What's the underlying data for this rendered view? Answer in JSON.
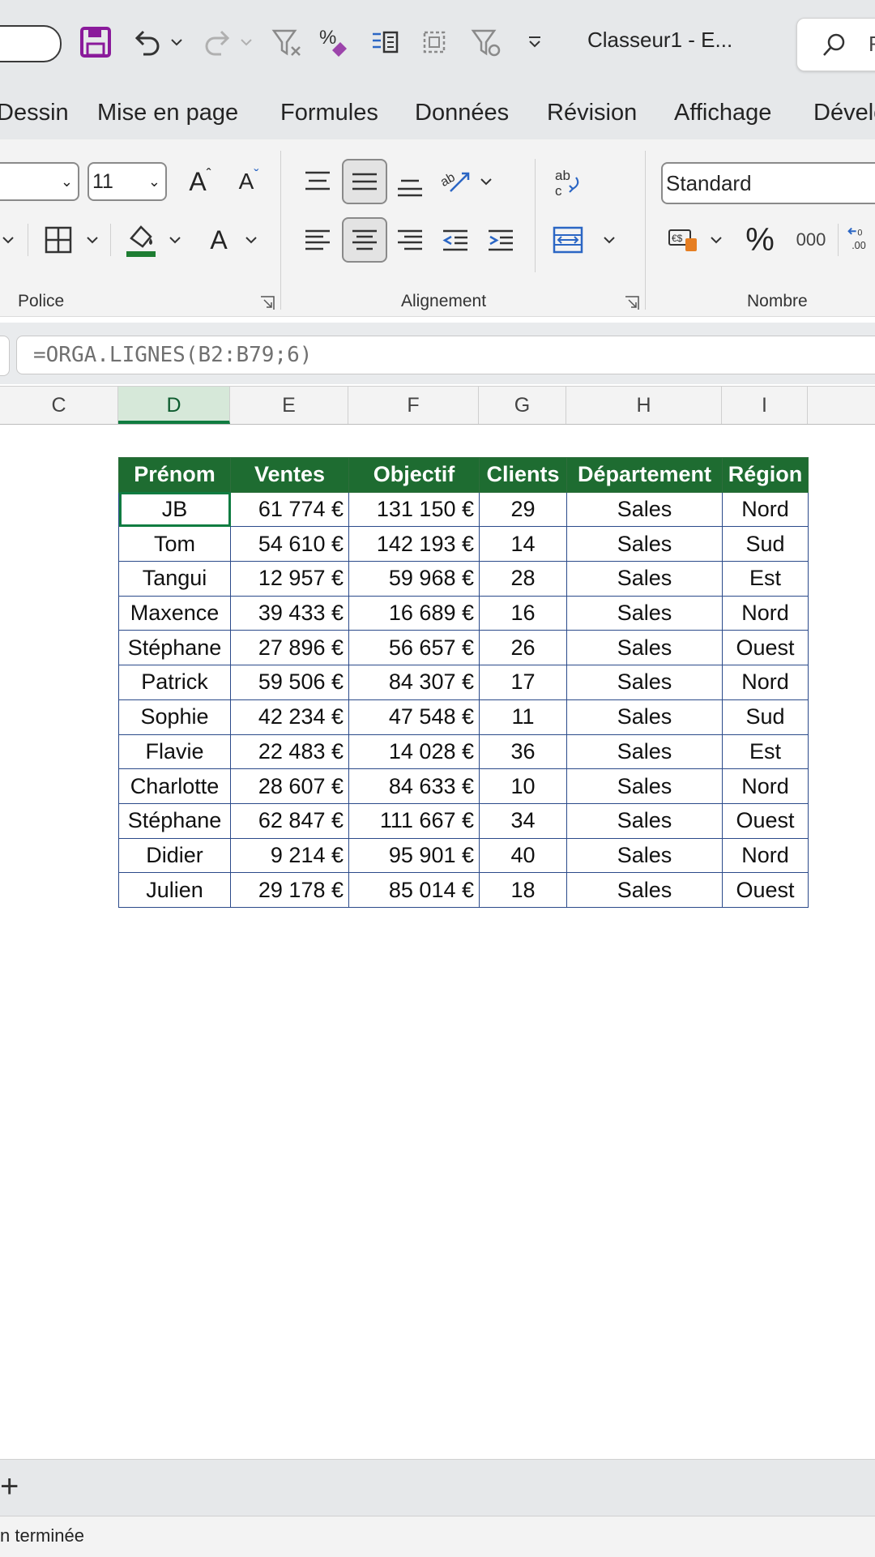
{
  "titlebar": {
    "doc_title": "Classeur1  -  E...",
    "search_placeholder_fragment": "R"
  },
  "tabs": [
    "Dessin",
    "Mise en page",
    "Formules",
    "Données",
    "Révision",
    "Affichage",
    "Dévelo"
  ],
  "ribbon": {
    "font_name": "",
    "font_size": "11",
    "grow_font": "A",
    "shrink_font": "A",
    "font_color_letter": "A",
    "number_format": "Standard",
    "thousands_label": "000",
    "groups": {
      "police": "Police",
      "alignement": "Alignement",
      "nombre": "Nombre"
    },
    "colors": {
      "accent_green": "#107c41",
      "save_purple": "#8a1a9b",
      "fill_green": "#1e7d32"
    }
  },
  "formula": "=ORGA.LIGNES(B2:B79;6)",
  "columns": [
    "C",
    "D",
    "E",
    "F",
    "G",
    "H",
    "I"
  ],
  "selected_column": "D",
  "table": {
    "headers": [
      "Prénom",
      "Ventes",
      "Objectif",
      "Clients",
      "Département",
      "Région"
    ],
    "rows": [
      [
        "JB",
        "61 774 €",
        "131 150 €",
        "29",
        "Sales",
        "Nord"
      ],
      [
        "Tom",
        "54 610 €",
        "142 193 €",
        "14",
        "Sales",
        "Sud"
      ],
      [
        "Tangui",
        "12 957 €",
        "59 968 €",
        "28",
        "Sales",
        "Est"
      ],
      [
        "Maxence",
        "39 433 €",
        "16 689 €",
        "16",
        "Sales",
        "Nord"
      ],
      [
        "Stéphane",
        "27 896 €",
        "56 657 €",
        "26",
        "Sales",
        "Ouest"
      ],
      [
        "Patrick",
        "59 506 €",
        "84 307 €",
        "17",
        "Sales",
        "Nord"
      ],
      [
        "Sophie",
        "42 234 €",
        "47 548 €",
        "11",
        "Sales",
        "Sud"
      ],
      [
        "Flavie",
        "22 483 €",
        "14 028 €",
        "36",
        "Sales",
        "Est"
      ],
      [
        "Charlotte",
        "28 607 €",
        "84 633 €",
        "10",
        "Sales",
        "Nord"
      ],
      [
        "Stéphane",
        "62 847 €",
        "111 667 €",
        "34",
        "Sales",
        "Ouest"
      ],
      [
        "Didier",
        "9 214 €",
        "95 901 €",
        "40",
        "Sales",
        "Nord"
      ],
      [
        "Julien",
        "29 178 €",
        "85 014 €",
        "18",
        "Sales",
        "Ouest"
      ]
    ]
  },
  "sheetbar": {
    "add_label": "+"
  },
  "status": {
    "text": "n terminée"
  }
}
